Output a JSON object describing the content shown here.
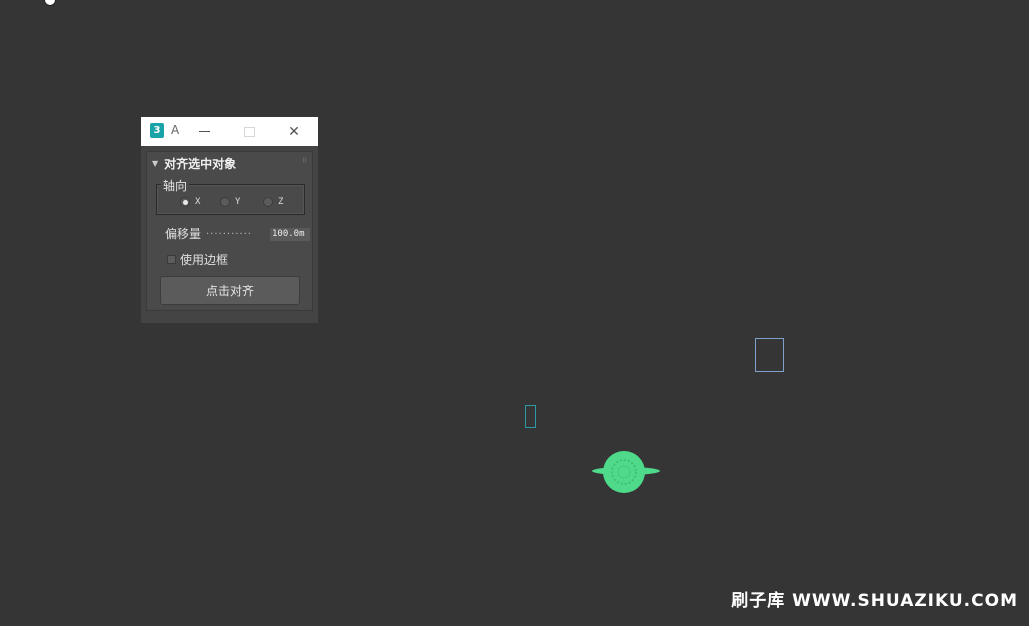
{
  "window": {
    "app_icon_glyph": "3",
    "title": "A",
    "minimize_icon": "minimize-icon",
    "maximize_icon": "maximize-icon",
    "close_icon": "close-icon",
    "close_glyph": "✕"
  },
  "rollout": {
    "arrow_glyph": "▼",
    "title": "对齐选中对象",
    "grip_glyph": "⠿",
    "axis_group": {
      "label": "轴向",
      "options": [
        {
          "label": "X",
          "selected": true
        },
        {
          "label": "Y",
          "selected": false
        },
        {
          "label": "Z",
          "selected": false
        }
      ]
    },
    "offset": {
      "label": "偏移量",
      "dots": "...........",
      "value": "100.0m"
    },
    "use_bbox": {
      "label": "使用边框",
      "checked": false
    },
    "align_button_label": "点击对齐"
  },
  "scene": {
    "green_color": "#4fd98a",
    "rect_big_color": "#7fa0c8",
    "rect_small_color": "#2b9aa5"
  },
  "watermark": "刷子库 WWW.SHUAZIKU.COM"
}
